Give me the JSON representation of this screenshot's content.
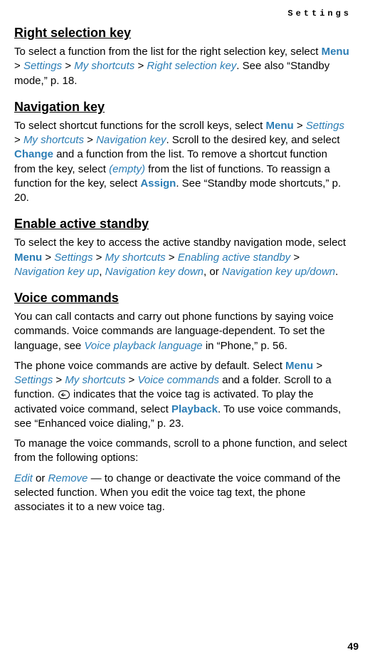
{
  "header": {
    "label": "Settings"
  },
  "page_number": "49",
  "s1": {
    "title": "Right selection key",
    "p1_a": "To select a function from the list for the right selection key, select ",
    "menu": "Menu",
    "gt": " > ",
    "settings": "Settings",
    "myshort": "My shortcuts",
    "rsk": "Right selection key",
    "p1_b": ". See also “Standby mode,” p. 18."
  },
  "s2": {
    "title": "Navigation key",
    "p1_a": "To select shortcut functions for the scroll keys, select ",
    "menu": "Menu",
    "gt1": " > ",
    "settings": "Settings",
    "gt2": " > ",
    "myshort": "My shortcuts",
    "gt3": " > ",
    "navkey": "Navigation key",
    "p1_b": ". Scroll to the desired key, and select ",
    "change": "Change",
    "p1_c": " and a function from the list. To remove a shortcut function from the key, select ",
    "empty": "(empty)",
    "p1_d": " from the list of functions. To reassign a function for the key, select ",
    "assign": "Assign",
    "p1_e": ". See “Standby mode shortcuts,” p. 20."
  },
  "s3": {
    "title": "Enable active standby",
    "p1_a": "To select the key to access the active standby navigation mode, select ",
    "menu": "Menu",
    "gt1": " > ",
    "settings": "Settings",
    "gt2": " > ",
    "myshort": "My shortcuts",
    "gt3": " > ",
    "eas": "Enabling active standby",
    "gt4": " > ",
    "nku": "Navigation key up",
    "comma": ", ",
    "nkd": "Navigation key down",
    "or": ", or ",
    "nkud": "Navigation key up/down",
    "dot": "."
  },
  "s4": {
    "title": "Voice commands",
    "p1_a": "You can call contacts and carry out phone functions by saying voice commands. Voice commands are language-dependent. To set the language, see ",
    "vpl": "Voice playback language",
    "p1_b": " in “Phone,” p. 56.",
    "p2_a": "The phone voice commands are active by default. Select ",
    "menu": "Menu",
    "gt1": " > ",
    "settings": "Settings",
    "gt2": " > ",
    "myshort": "My shortcuts",
    "gt3": " > ",
    "vc": "Voice commands",
    "p2_b": " and a folder. Scroll to a function. ",
    "p2_c": " indicates that the voice tag is activated. To play the activated voice command, select ",
    "playback": "Playback",
    "p2_d": ". To use voice commands, see “Enhanced voice dialing,” p. 23.",
    "p3": "To manage the voice commands, scroll to a phone function, and select from the following options:",
    "edit": "Edit",
    "p4_a": " or ",
    "remove": "Remove",
    "p4_b": " — to change or deactivate the voice command of the selected function. When you edit the voice tag text, the phone associates it to a new  voice tag."
  }
}
